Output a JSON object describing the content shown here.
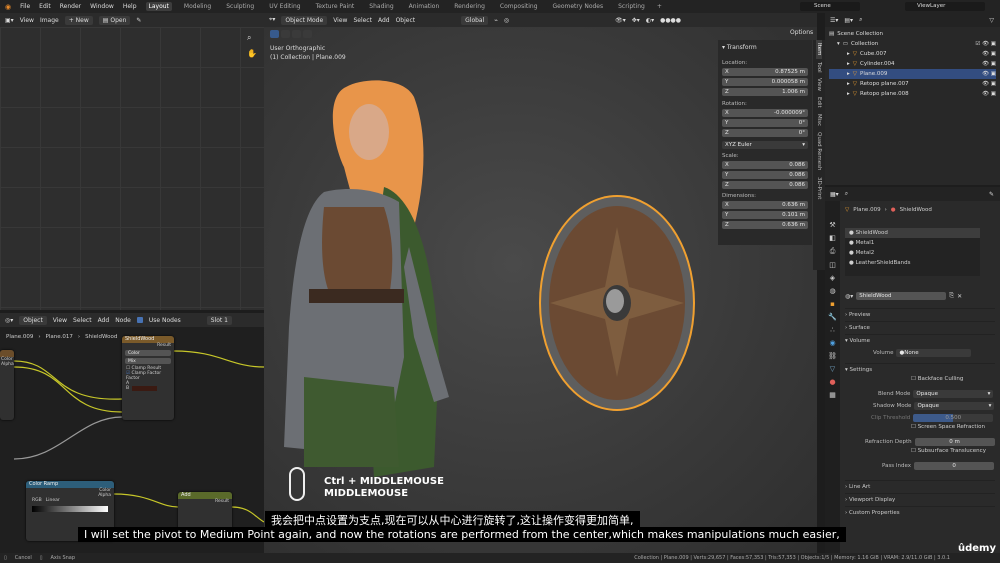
{
  "menu": {
    "items": [
      "File",
      "Edit",
      "Render",
      "Window",
      "Help"
    ]
  },
  "workspaces": [
    "Layout",
    "Modeling",
    "Sculpting",
    "UV Editing",
    "Texture Paint",
    "Shading",
    "Animation",
    "Rendering",
    "Compositing",
    "Geometry Nodes",
    "Scripting"
  ],
  "scene": {
    "label": "Scene",
    "view_layer": "ViewLayer"
  },
  "image_editor": {
    "view": "View",
    "image": "Image",
    "new": "New",
    "open": "Open"
  },
  "viewport": {
    "mode": "Object Mode",
    "menus": [
      "View",
      "Select",
      "Add",
      "Object"
    ],
    "transform": "Global",
    "options": "Options",
    "view_name": "User Orthographic",
    "collection_info": "(1) Collection | Plane.009",
    "shortcut_line1": "Ctrl + MIDDLEMOUSE",
    "shortcut_line2": "MIDDLEMOUSE"
  },
  "npanel": {
    "title": "Transform",
    "location_label": "Location:",
    "location": [
      {
        "axis": "X",
        "value": "0.87525 m"
      },
      {
        "axis": "Y",
        "value": "0.000058 m"
      },
      {
        "axis": "Z",
        "value": "1.006 m"
      }
    ],
    "rotation_label": "Rotation:",
    "rotation": [
      {
        "axis": "X",
        "value": "-0.000009°"
      },
      {
        "axis": "Y",
        "value": "0°"
      },
      {
        "axis": "Z",
        "value": "0°"
      }
    ],
    "rotation_mode": "XYZ Euler",
    "scale_label": "Scale:",
    "scale": [
      {
        "axis": "X",
        "value": "0.086"
      },
      {
        "axis": "Y",
        "value": "0.086"
      },
      {
        "axis": "Z",
        "value": "0.086"
      }
    ],
    "dimensions_label": "Dimensions:",
    "dimensions": [
      {
        "axis": "X",
        "value": "0.636 m"
      },
      {
        "axis": "Y",
        "value": "0.101 m"
      },
      {
        "axis": "Z",
        "value": "0.636 m"
      }
    ],
    "tabs": [
      "Item",
      "Tool",
      "View",
      "Edit",
      "Misc",
      "Quad Remesh",
      "3D-Print"
    ]
  },
  "outliner": {
    "root": "Scene Collection",
    "collection": "Collection",
    "items": [
      "Cube.007",
      "Cylinder.004",
      "Plane.009",
      "Retopo plane.007",
      "Retopo plane.008"
    ],
    "selected_index": 2
  },
  "properties": {
    "object": "Plane.009",
    "material": "ShieldWood",
    "slots": [
      "ShieldWood",
      "Metal1",
      "Metal2",
      "LeatherShieldBands"
    ],
    "panels": {
      "preview": "Preview",
      "surface": "Surface",
      "volume": "Volume",
      "settings": "Settings",
      "line_art": "Line Art",
      "viewport_display": "Viewport Display",
      "custom_properties": "Custom Properties"
    },
    "volume_label": "Volume",
    "volume_value": "None",
    "backface_culling": "Backface Culling",
    "blend_mode_label": "Blend Mode",
    "blend_mode": "Opaque",
    "shadow_mode_label": "Shadow Mode",
    "shadow_mode": "Opaque",
    "clip_threshold_label": "Clip Threshold",
    "clip_threshold": "0.500",
    "screen_space_refraction": "Screen Space Refraction",
    "refraction_depth_label": "Refraction Depth",
    "refraction_depth": "0 m",
    "subsurface_translucency": "Subsurface Translucency",
    "pass_index_label": "Pass Index",
    "pass_index": "0"
  },
  "node_editor": {
    "mode": "Object",
    "menus": [
      "View",
      "Select",
      "Add",
      "Node"
    ],
    "use_nodes": "Use Nodes",
    "slot": "Slot 1",
    "breadcrumb": [
      "Plane.009",
      "Plane.017",
      "ShieldWood"
    ],
    "mix_node": {
      "title": "ShieldWood",
      "result": "Result",
      "color": "Color",
      "mix": "Mix",
      "clamp_result": "Clamp Result",
      "clamp_factor": "Clamp Factor",
      "factor": "Factor",
      "a": "A",
      "b": "B"
    },
    "color_ramp": {
      "title": "Color Ramp",
      "color": "Color",
      "alpha": "Alpha",
      "rgb": "RGB",
      "linear": "Linear"
    },
    "small_node": {
      "title": "Add",
      "result": "Result"
    },
    "left_node": {
      "color": "Color",
      "alpha": "Alpha"
    }
  },
  "subtitles": {
    "chinese": "我会把中点设置为支点,现在可以从中心进行旋转了,这让操作变得更加简单,",
    "english": "I will set the pivot to Medium Point again, and now the rotations are performed from the center,which makes manipulations much easier,"
  },
  "statusbar": {
    "left1": "Cancel",
    "left2": "Axis Snap",
    "info": "Collection | Plane.009 | Verts:29,657 | Faces:57,353 | Tris:57,353 | Objects:1/5 | Memory: 1.16 GiB | VRAM: 2.9/11.0 GiB | 3.0.1"
  },
  "watermark": "ûdemy",
  "colors": {
    "accent": "#375a8c",
    "selection": "#f0a030",
    "hair": "#e8954a",
    "cloak": "#3c5a2e",
    "wood": "#6b4a33"
  }
}
